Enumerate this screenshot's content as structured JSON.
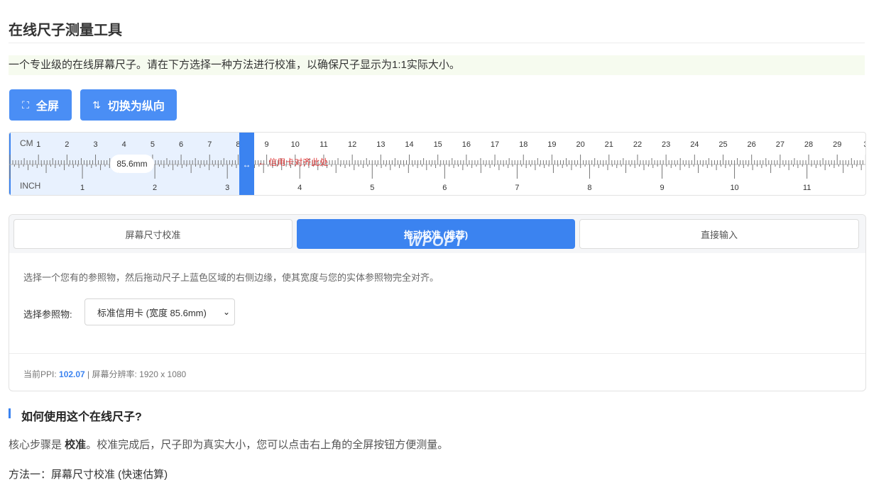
{
  "page": {
    "title": "在线尺子测量工具",
    "intro": "一个专业级的在线屏幕尺子。请在下方选择一种方法进行校准，以确保尺子显示为1:1实际大小。"
  },
  "toolbar": {
    "fullscreen_label": "全屏",
    "fullscreen_icon": "fullscreen-icon",
    "orientation_label": "切换为纵向",
    "orientation_icon": "swap-vertical-icon"
  },
  "ruler": {
    "cm_unit": "CM",
    "inch_unit": "INCH",
    "cm_labels": [
      "1",
      "2",
      "3",
      "4",
      "5",
      "6",
      "7",
      "8",
      "9",
      "10",
      "11",
      "12",
      "13",
      "14",
      "15",
      "16",
      "17",
      "18",
      "19",
      "20",
      "21",
      "22",
      "23",
      "24",
      "25",
      "26",
      "27",
      "28",
      "29",
      "3"
    ],
    "inch_labels": [
      "1",
      "2",
      "3",
      "4",
      "5",
      "6",
      "7",
      "8",
      "9",
      "10",
      "11"
    ],
    "width_badge": "85.6mm",
    "handle_glyph": "↔",
    "align_label": "← 信用卡对齐此处",
    "selection_width_mm": 85.6,
    "colors": {
      "selection": "#e8f1fe",
      "handle": "#3b83f0",
      "align_label": "#e03e3e"
    }
  },
  "calibration": {
    "tabs": [
      {
        "label": "屏幕尺寸校准"
      },
      {
        "label": "拖动校准 (推荐)"
      },
      {
        "label": "直接输入"
      }
    ],
    "active_tab": 1,
    "watermark": "WPOPT",
    "instructions": "选择一个您有的参照物，然后拖动尺子上蓝色区域的右侧边缘，使其宽度与您的实体参照物完全对齐。",
    "reference_label": "选择参照物:",
    "reference_selected": "标准信用卡 (宽度 85.6mm)",
    "status_ppi_label": "当前PPI: ",
    "status_ppi_value": "102.07",
    "status_resolution": " | 屏幕分辨率: 1920 x 1080"
  },
  "howto": {
    "title": "如何使用这个在线尺子?",
    "core_prefix": "核心步骤是 ",
    "core_bold": "校准",
    "core_suffix": "。校准完成后，尺子即为真实大小，您可以点击右上角的全屏按钮方便测量。",
    "method1": "方法一：屏幕尺寸校准 (快速估算)"
  }
}
